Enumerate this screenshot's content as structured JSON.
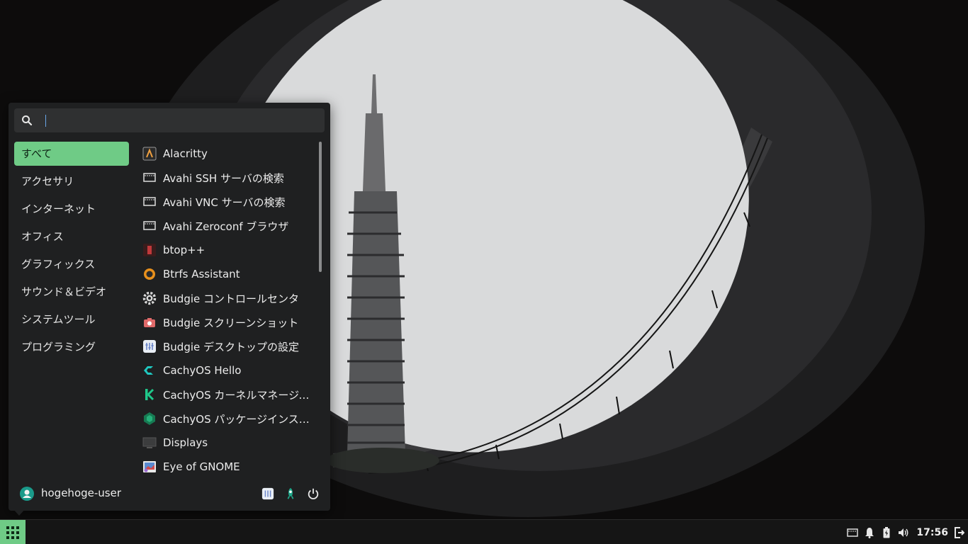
{
  "search": {
    "placeholder": "",
    "value": ""
  },
  "categories": [
    {
      "label": "すべて",
      "active": true
    },
    {
      "label": "アクセサリ"
    },
    {
      "label": "インターネット"
    },
    {
      "label": "オフィス"
    },
    {
      "label": "グラフィックス"
    },
    {
      "label": "サウンド＆ビデオ"
    },
    {
      "label": "システムツール"
    },
    {
      "label": "プログラミング"
    }
  ],
  "apps": [
    {
      "label": "Alacritty",
      "icon": "alacritty-icon"
    },
    {
      "label": "Avahi SSH サーバの検索",
      "icon": "network-icon"
    },
    {
      "label": "Avahi VNC サーバの検索",
      "icon": "network-icon"
    },
    {
      "label": "Avahi Zeroconf ブラウザ",
      "icon": "network-icon"
    },
    {
      "label": "btop++",
      "icon": "btop-icon"
    },
    {
      "label": "Btrfs Assistant",
      "icon": "btrfs-icon"
    },
    {
      "label": "Budgie コントロールセンタ",
      "icon": "gear-icon"
    },
    {
      "label": "Budgie スクリーンショット",
      "icon": "camera-icon"
    },
    {
      "label": "Budgie デスクトップの設定",
      "icon": "desktop-settings-icon"
    },
    {
      "label": "CachyOS Hello",
      "icon": "cachyos-icon"
    },
    {
      "label": "CachyOS カーネルマネージャー",
      "icon": "kernel-manager-icon"
    },
    {
      "label": "CachyOS パッケージインストール",
      "icon": "package-installer-icon"
    },
    {
      "label": "Displays",
      "icon": "display-icon"
    },
    {
      "label": "Eye of GNOME",
      "icon": "image-viewer-icon"
    }
  ],
  "footer": {
    "username": "hogehoge-user"
  },
  "panel": {
    "clock": "17:56"
  },
  "colors": {
    "accent": "#6fcb86",
    "menu_bg": "#1f2021",
    "panel_bg": "#151515"
  }
}
